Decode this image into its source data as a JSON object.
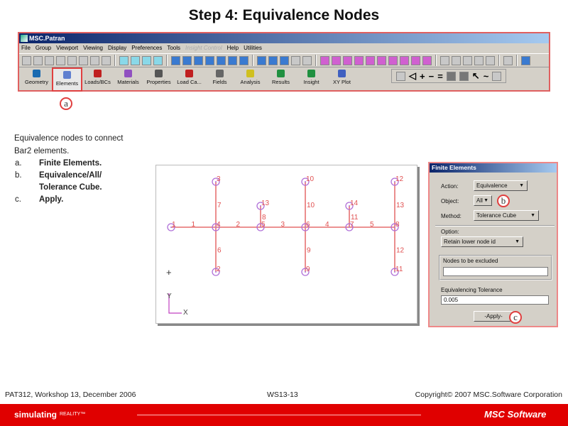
{
  "slide_title": "Step 4:  Equivalence Nodes",
  "app": {
    "title": "MSC.Patran",
    "menu": [
      "File",
      "Group",
      "Viewport",
      "Viewing",
      "Display",
      "Preferences",
      "Tools",
      "Insight Control",
      "Help",
      "Utilities"
    ],
    "apps": [
      "Geometry",
      "Elements",
      "Loads/BCs",
      "Materials",
      "Properties",
      "Load Ca...",
      "Fields",
      "Analysis",
      "Results",
      "Insight",
      "XY Plot"
    ],
    "selected_app": "Elements"
  },
  "callouts": {
    "a": "a",
    "b": "b",
    "c": "c"
  },
  "instructions": {
    "intro_line1": "Equivalence nodes to connect",
    "intro_line2": "Bar2 elements.",
    "steps": [
      {
        "letter": "a.",
        "text": "Finite Elements."
      },
      {
        "letter": "b.",
        "text": "Equivalence/All/ Tolerance Cube."
      },
      {
        "letter": "c.",
        "text": "Apply."
      }
    ]
  },
  "viewport": {
    "nodes": [
      "1",
      "2",
      "3",
      "4",
      "5",
      "6",
      "7",
      "8",
      "9",
      "10",
      "11",
      "12",
      "13",
      "14"
    ],
    "elements": [
      "1",
      "2",
      "3",
      "4",
      "5",
      "6",
      "7",
      "8",
      "9",
      "10",
      "11",
      "12",
      "13"
    ],
    "axis_y": "Y",
    "axis_x": "X",
    "colors": {
      "element": "#e05050",
      "node": "#b070d8"
    }
  },
  "dialog": {
    "title": "Finite Elements",
    "action_label": "Action:",
    "action_value": "Equivalence",
    "object_label": "Object:",
    "object_value": "All",
    "method_label": "Method:",
    "method_value": "Tolerance Cube",
    "option_label": "Option:",
    "option_value": "Retain lower node id",
    "exclude_label": "Nodes to be excluded",
    "exclude_value": "",
    "tolerance_label": "Equivalencing Tolerance",
    "tolerance_value": "0.005",
    "apply_label": "-Apply-"
  },
  "footer": {
    "left": "PAT312, Workshop 13, December 2006",
    "center": "WS13-13",
    "right": "Copyright© 2007 MSC.Software Corporation",
    "tagline": "simulating",
    "tagline_small": "REALITY™",
    "brand": "MSC Software"
  }
}
